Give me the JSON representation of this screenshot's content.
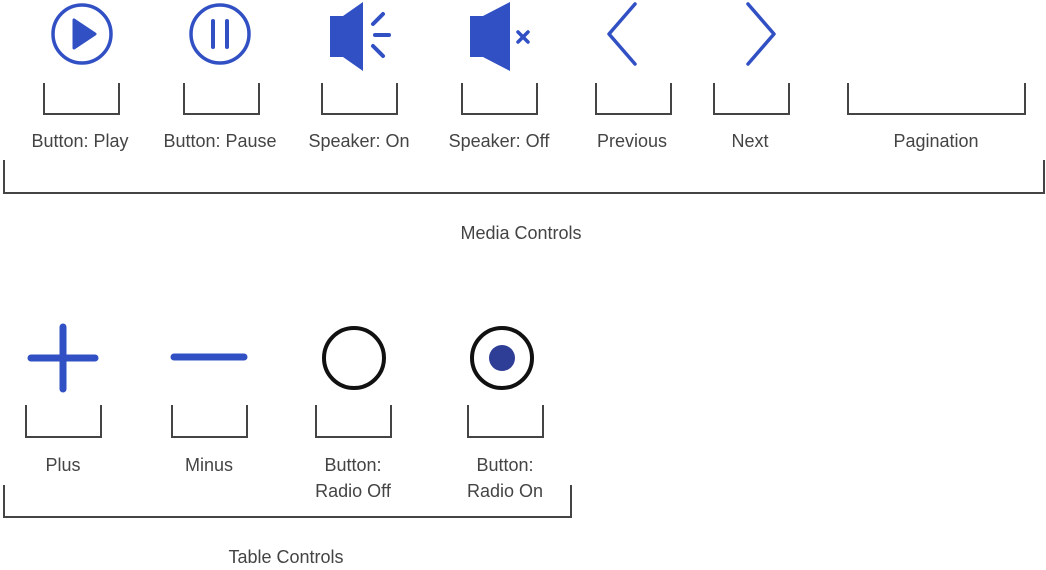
{
  "colors": {
    "accent": "#3150c4",
    "radio_off": "#111111",
    "radio_on_ring": "#111111",
    "radio_on_dot": "#2e3e96",
    "bracket": "#444444",
    "text": "#444444"
  },
  "media_controls": {
    "group_label": "Media Controls",
    "items": [
      {
        "icon": "play-circle-icon",
        "label": "Button: Play"
      },
      {
        "icon": "pause-circle-icon",
        "label": "Button: Pause"
      },
      {
        "icon": "speaker-on-icon",
        "label": "Speaker: On"
      },
      {
        "icon": "speaker-off-icon",
        "label": "Speaker: Off"
      },
      {
        "icon": "chevron-left-icon",
        "label": "Previous"
      },
      {
        "icon": "chevron-right-icon",
        "label": "Next"
      },
      {
        "icon": "",
        "label": "Pagination"
      }
    ]
  },
  "table_controls": {
    "group_label": "Table Controls",
    "items": [
      {
        "icon": "plus-icon",
        "label": "Plus"
      },
      {
        "icon": "minus-icon",
        "label": "Minus"
      },
      {
        "icon": "radio-off-icon",
        "label_line1": "Button:",
        "label_line2": "Radio Off"
      },
      {
        "icon": "radio-on-icon",
        "label_line1": "Button:",
        "label_line2": "Radio On"
      }
    ]
  }
}
